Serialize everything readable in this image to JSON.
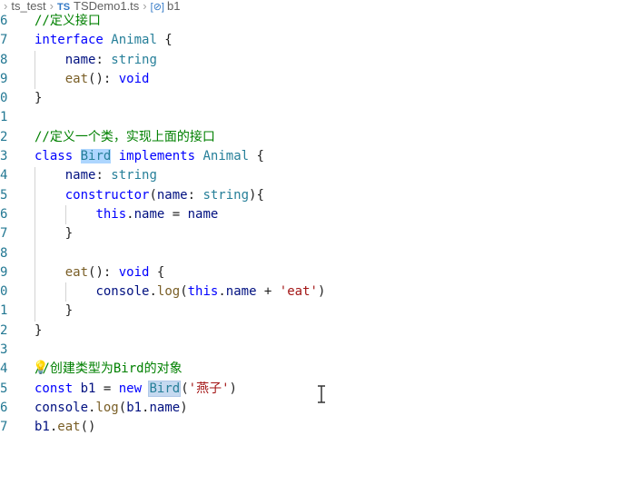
{
  "breadcrumb": {
    "folder": "ts_test",
    "file_badge": "TS",
    "file": "TSDemo1.ts",
    "symbol_icon": "variable-icon",
    "symbol": "b1"
  },
  "lines": [
    {
      "num": "6",
      "text": "//定义接口"
    },
    {
      "num": "7",
      "text": "interface Animal {"
    },
    {
      "num": "8",
      "text": "    name: string"
    },
    {
      "num": "9",
      "text": "    eat(): void"
    },
    {
      "num": "0",
      "text": "}"
    },
    {
      "num": "1",
      "text": ""
    },
    {
      "num": "2",
      "text": "//定义一个类，实现上面的接口"
    },
    {
      "num": "3",
      "text": "class Bird implements Animal {"
    },
    {
      "num": "4",
      "text": "    name: string"
    },
    {
      "num": "5",
      "text": "    constructor(name: string){"
    },
    {
      "num": "6",
      "text": "        this.name = name"
    },
    {
      "num": "7",
      "text": "    }"
    },
    {
      "num": "8",
      "text": ""
    },
    {
      "num": "9",
      "text": "    eat(): void {"
    },
    {
      "num": "0",
      "text": "        console.log(this.name + 'eat')"
    },
    {
      "num": "1",
      "text": "    }"
    },
    {
      "num": "2",
      "text": "}"
    },
    {
      "num": "3",
      "text": ""
    },
    {
      "num": "4",
      "text": "//创建类型为Bird的对象"
    },
    {
      "num": "5",
      "text": "const b1 = new Bird('燕子')"
    },
    {
      "num": "6",
      "text": "console.log(b1.name)"
    },
    {
      "num": "7",
      "text": "b1.eat()"
    }
  ],
  "tokens": {
    "interface": "interface",
    "Animal": "Animal",
    "name": "name",
    "string": "string",
    "eat": "eat",
    "void": "void",
    "class": "class",
    "Bird": "Bird",
    "implements": "implements",
    "constructor": "constructor",
    "this": "this",
    "console": "console",
    "log": "log",
    "eat_str": "'eat'",
    "const": "const",
    "b1": "b1",
    "new": "new",
    "yanzi": "'燕子'",
    "comment1": "//定义接口",
    "comment2": "//定义一个类，实现上面的接口",
    "comment3_a": "//创建类型为",
    "comment3_b": "Bird",
    "comment3_c": "的对象"
  },
  "colors": {
    "keyword": "#0000ff",
    "type": "#267f99",
    "function": "#795e26",
    "string": "#a31515",
    "comment": "#008000",
    "line_number": "#237893",
    "highlight": "#add6ff"
  }
}
